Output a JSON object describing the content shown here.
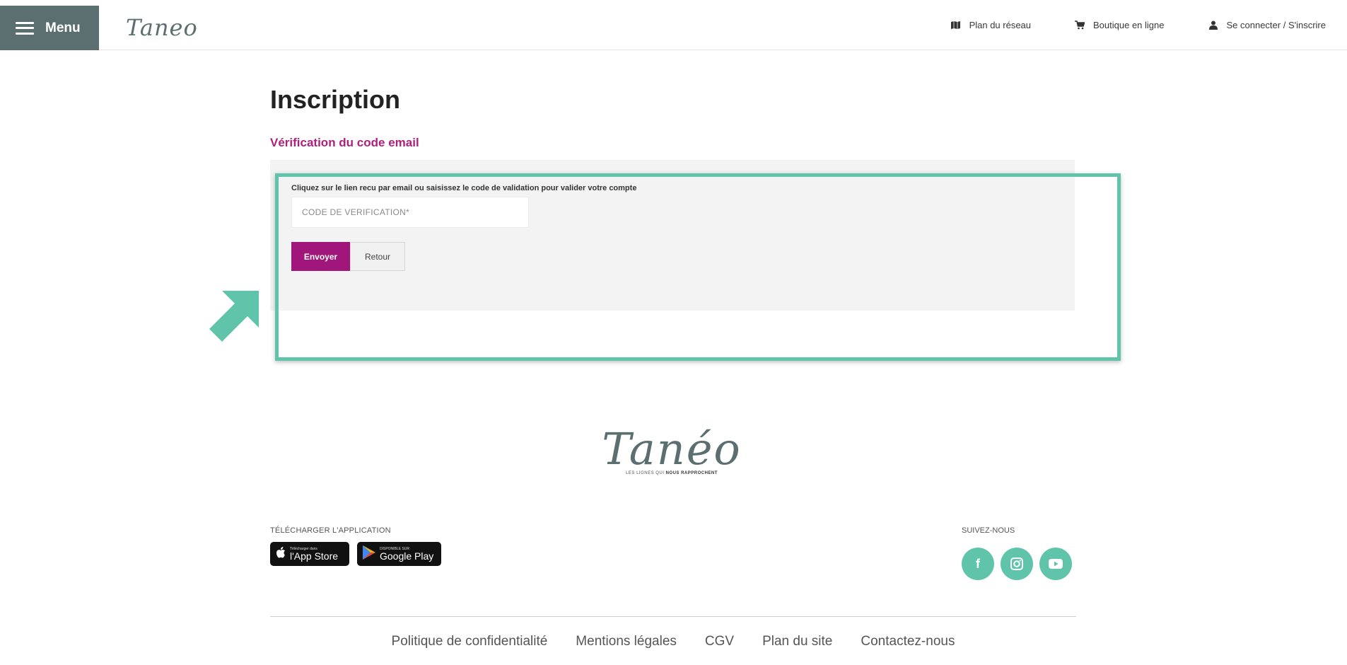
{
  "header": {
    "menu_label": "Menu",
    "logo_text": "Taneo",
    "nav": {
      "plan_label": "Plan du réseau",
      "shop_label": "Boutique en ligne",
      "login_label": "Se connecter / S'inscrire"
    }
  },
  "main": {
    "title": "Inscription",
    "subtitle": "Vérification du code email",
    "instruction": "Cliquez sur le lien recu par email ou saisissez le code de validation pour valider votre compte",
    "code_placeholder": "CODE DE VERIFICATION*",
    "send_label": "Envoyer",
    "back_label": "Retour"
  },
  "footer": {
    "logo_text": "Tanéo",
    "tagline_prefix": "LES LIGNES QUI",
    "tagline_bold": "NOUS RAPPROCHENT",
    "download_title": "TÉLÉCHARGER L'APPLICATION",
    "appstore_small": "Télécharger dans",
    "appstore_name": "l'App Store",
    "googleplay_small": "DISPONIBLE SUR",
    "googleplay_name": "Google Play",
    "follow_title": "SUIVEZ-NOUS",
    "links": [
      "Politique de confidentialité",
      "Mentions légales",
      "CGV",
      "Plan du site",
      "Contactez-nous"
    ]
  },
  "colors": {
    "header_menu_bg": "#5b6f70",
    "accent_magenta": "#a0167a",
    "highlight_teal": "#5fc4aa"
  },
  "icons": {
    "menu": "hamburger-icon",
    "plan": "map-icon",
    "shop": "cart-icon",
    "login": "user-icon",
    "facebook": "facebook-icon",
    "instagram": "instagram-icon",
    "youtube": "youtube-icon"
  }
}
